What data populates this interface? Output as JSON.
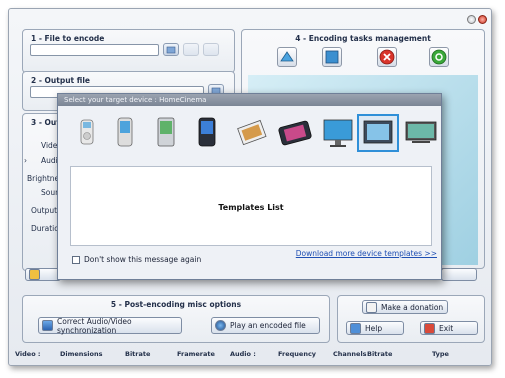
{
  "sections": {
    "file_to_encode": "1 - File to encode",
    "output_file": "2 - Output file",
    "output_settings_partial": "3 - Outp",
    "encoding_tasks": "4 - Encoding tasks management",
    "post_encoding": "5 - Post-encoding misc options"
  },
  "settings_labels": {
    "video": "Video",
    "audio": "Audio",
    "brightness": "Brightnes",
    "sound": "Soun",
    "output_d": "Output d",
    "duration": "Duration"
  },
  "dialog": {
    "title": "Select your target device : HomeCinema",
    "templates_label": "Templates List",
    "download_link": "Download more device templates >>",
    "checkbox_label": "Don't show this message again",
    "devices": [
      "ipod-icon",
      "smartphone-icon",
      "pda-icon",
      "pocket-pc-icon",
      "photo-viewer-icon",
      "portable-media-player-icon",
      "monitor-icon",
      "homecinema-tv-icon",
      "widescreen-tv-icon"
    ],
    "selected_device": "homecinema-tv-icon"
  },
  "buttons": {
    "correct_sync": "Correct Audio/Video synchronization",
    "play_encoded": "Play an encoded file",
    "donation": "Make a donation",
    "help": "Help",
    "exit": "Exit"
  },
  "status_columns": [
    "Video :",
    "Dimensions",
    "Bitrate",
    "Framerate",
    "Audio :",
    "Frequency",
    "Channels",
    "Bitrate",
    "Type"
  ],
  "colors": {
    "accent": "#2f8fd8",
    "link": "#1f4fb3",
    "stop_red": "#d9342b",
    "go_green": "#3aa83a"
  }
}
